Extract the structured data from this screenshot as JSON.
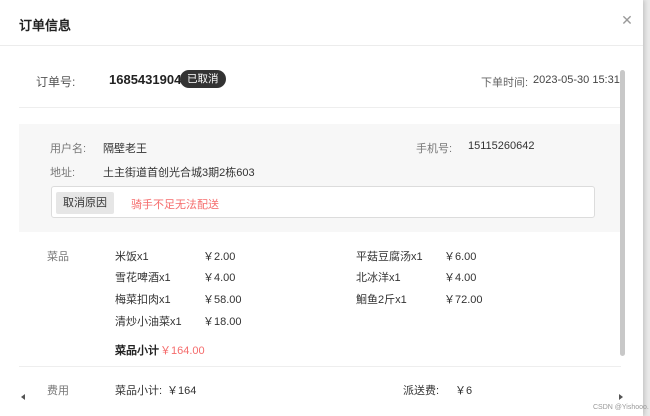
{
  "dialog": {
    "title": "订单信息",
    "close_icon": "close-icon"
  },
  "order": {
    "number_label": "订单号:",
    "number": "1685431904082",
    "status": "已取消",
    "time_label": "下单时间:",
    "time": "2023-05-30 15:31"
  },
  "user": {
    "name_label": "用户名:",
    "name": "隔壁老王",
    "phone_label": "手机号:",
    "phone": "15115260642",
    "address_label": "地址:",
    "address": "土主街道首创光合城3期2栋603"
  },
  "cancel": {
    "reason_tag": "取消原因",
    "reason": "骑手不足无法配送"
  },
  "dishes": {
    "label": "菜品",
    "left": [
      {
        "name": "米饭x1",
        "price": "￥2.00"
      },
      {
        "name": "雪花啤酒x1",
        "price": "￥4.00"
      },
      {
        "name": "梅菜扣肉x1",
        "price": "￥58.00"
      },
      {
        "name": "清炒小油菜x1",
        "price": "￥18.00"
      }
    ],
    "right": [
      {
        "name": "平菇豆腐汤x1",
        "price": "￥6.00"
      },
      {
        "name": "北冰洋x1",
        "price": "￥4.00"
      },
      {
        "name": "鮰鱼2斤x1",
        "price": "￥72.00"
      }
    ],
    "subtotal_label": "菜品小计",
    "subtotal": "￥164.00"
  },
  "fees": {
    "label": "费用",
    "subtotal_label": "菜品小计:",
    "subtotal": "￥164",
    "delivery_label": "派送费:",
    "delivery": "￥6"
  },
  "watermark": "CSDN @Yishooo.",
  "colors": {
    "accent_red": "#f56c6c",
    "badge_bg": "#333333"
  }
}
